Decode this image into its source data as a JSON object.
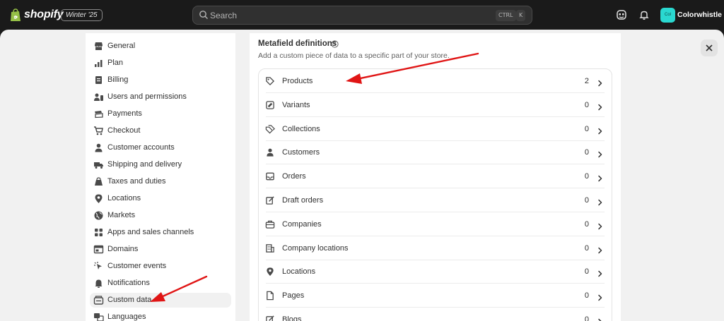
{
  "topbar": {
    "brand": "shopify",
    "edition": "Winter '25",
    "search_placeholder": "Search",
    "shortcut_1": "CTRL",
    "shortcut_2": "K",
    "avatar_initials": "Col",
    "store_name": "Colorwhistle"
  },
  "sidebar": {
    "items": [
      {
        "label": "General",
        "icon": "store-icon"
      },
      {
        "label": "Plan",
        "icon": "plan-chart-icon"
      },
      {
        "label": "Billing",
        "icon": "billing-icon"
      },
      {
        "label": "Users and permissions",
        "icon": "users-icon"
      },
      {
        "label": "Payments",
        "icon": "payments-icon"
      },
      {
        "label": "Checkout",
        "icon": "cart-icon"
      },
      {
        "label": "Customer accounts",
        "icon": "person-icon"
      },
      {
        "label": "Shipping and delivery",
        "icon": "truck-icon"
      },
      {
        "label": "Taxes and duties",
        "icon": "tax-bag-icon"
      },
      {
        "label": "Locations",
        "icon": "location-pin-icon"
      },
      {
        "label": "Markets",
        "icon": "globe-icon"
      },
      {
        "label": "Apps and sales channels",
        "icon": "apps-icon"
      },
      {
        "label": "Domains",
        "icon": "domains-icon"
      },
      {
        "label": "Customer events",
        "icon": "cursor-icon"
      },
      {
        "label": "Notifications",
        "icon": "bell-icon"
      },
      {
        "label": "Custom data",
        "icon": "custom-data-icon",
        "active": true
      },
      {
        "label": "Languages",
        "icon": "languages-icon"
      }
    ]
  },
  "metafields": {
    "title": "Metafield definitions",
    "subtitle": "Add a custom piece of data to a specific part of your store.",
    "rows": [
      {
        "label": "Products",
        "count": "2",
        "icon": "tag-icon"
      },
      {
        "label": "Variants",
        "count": "0",
        "icon": "variants-icon"
      },
      {
        "label": "Collections",
        "count": "0",
        "icon": "collections-icon"
      },
      {
        "label": "Customers",
        "count": "0",
        "icon": "person-icon"
      },
      {
        "label": "Orders",
        "count": "0",
        "icon": "inbox-icon"
      },
      {
        "label": "Draft orders",
        "count": "0",
        "icon": "draft-order-icon"
      },
      {
        "label": "Companies",
        "count": "0",
        "icon": "briefcase-icon"
      },
      {
        "label": "Company locations",
        "count": "0",
        "icon": "building-icon"
      },
      {
        "label": "Locations",
        "count": "0",
        "icon": "location-pin-icon"
      },
      {
        "label": "Pages",
        "count": "0",
        "icon": "page-icon"
      },
      {
        "label": "Blogs",
        "count": "0",
        "icon": "blog-icon"
      }
    ]
  },
  "colors": {
    "topbar": "#1a1a1a",
    "avatar": "#2ad8d0",
    "annotation_arrow": "#e01515",
    "active_item": "#f1f1f1"
  }
}
